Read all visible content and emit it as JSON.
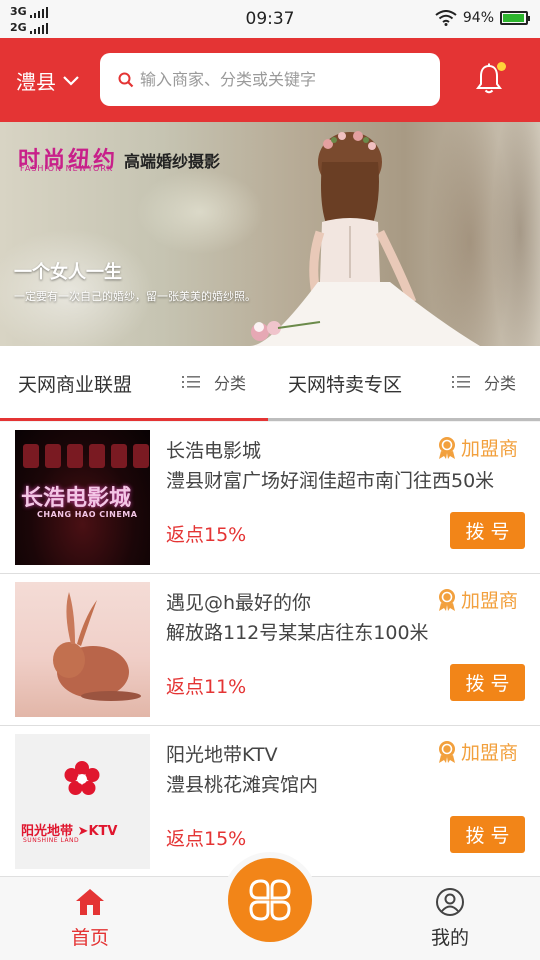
{
  "status_bar": {
    "sim1": "3G",
    "sim2": "2G",
    "time": "09:37",
    "battery": "94%",
    "battery_level": 0.94
  },
  "header": {
    "city": "澧县",
    "search_placeholder": "输入商家、分类或关键字",
    "has_notification": true,
    "accent_color": "#e43434"
  },
  "banner": {
    "brand_main": "时尚纽约",
    "brand_sub": "高端婚纱摄影",
    "brand_en": "FASHION NEWYORK",
    "title": "一个女人一生",
    "text": "一定要有一次自己的婚纱，留一张美美的婚纱照。"
  },
  "tabs": {
    "left_label": "天网商业联盟",
    "left_category": "分类",
    "right_label": "天网特卖专区",
    "right_category": "分类",
    "active": "left"
  },
  "merchants": [
    {
      "name": "长浩电影城",
      "address": "澧县财富广场好润佳超市南门往西50米",
      "badge": "加盟商",
      "rebate": "返点15%",
      "call_label": "拨号",
      "logo_text": "长浩电影城",
      "logo_en": "CHANG HAO CINEMA"
    },
    {
      "name": "遇见@h最好的你",
      "address": "解放路112号某某店往东100米",
      "badge": "加盟商",
      "rebate": "返点11%",
      "call_label": "拨号"
    },
    {
      "name": "阳光地带KTV",
      "address": "澧县桃花滩宾馆内",
      "badge": "加盟商",
      "rebate": "返点15%",
      "call_label": "拨号",
      "logo_text": "阳光地带",
      "logo_suffix": "KTV",
      "logo_en": "SUNSHINE LAND"
    }
  ],
  "bottom_nav": {
    "home": "首页",
    "mine": "我的",
    "active": "home"
  },
  "colors": {
    "accent_red": "#e43434",
    "orange": "#f28518",
    "badge_orange": "#f2a03d"
  },
  "icons": {
    "city_dropdown": "chevron-down-icon",
    "search": "search-icon",
    "bell": "bell-icon",
    "category": "list-icon",
    "badge": "award-icon",
    "home": "home-icon",
    "center": "grid-icon",
    "mine": "user-icon"
  }
}
